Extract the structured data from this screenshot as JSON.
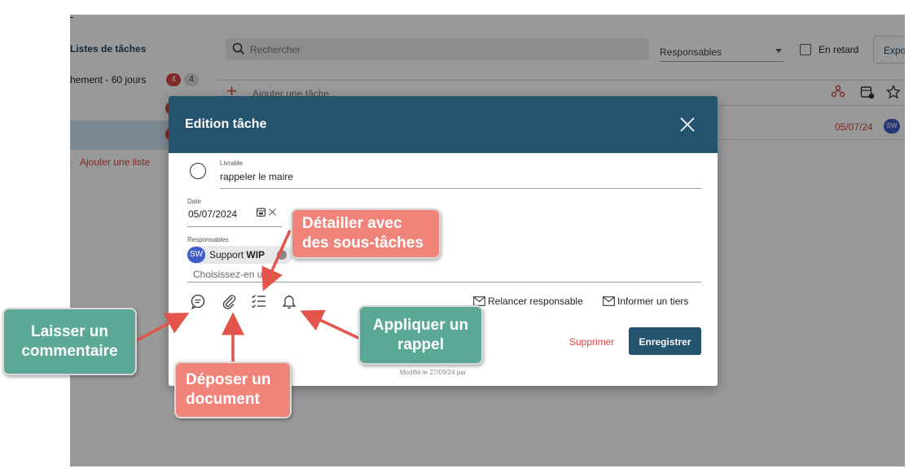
{
  "app": {
    "lists_title": "Listes de tâches",
    "list_item_label": "hement - 60 jours",
    "badge_red": "4",
    "badge_grey": "4",
    "add_list": "Ajouter une liste",
    "search_placeholder": "Rechercher",
    "responsables_select": "Responsables",
    "late_label": "En retard",
    "export_label": "Expo",
    "add_task": "Ajouter une tâche",
    "row_date": "05/07/24",
    "row_avatar": "SW"
  },
  "modal": {
    "title": "Edition tâche",
    "livrable_label": "Livrable",
    "livrable_value": "rappeler le maire",
    "date_label": "Date",
    "date_value": "05/07/2024",
    "responsables_label": "Responsables",
    "chip_avatar": "SW",
    "chip_name": "Support",
    "chip_name_bold": "WIP",
    "choose_placeholder": "Choisissez-en u",
    "relancer": "Relancer responsable",
    "informer": "Informer un tiers",
    "delete": "Supprimer",
    "save": "Enregistrer",
    "modified": "Modifié le 27/09/24 par"
  },
  "icons": [
    "search-icon",
    "caret-down-icon",
    "team-icon",
    "calendar-add-icon",
    "star-icon",
    "close-icon",
    "calendar-icon",
    "clear-icon",
    "comment-icon",
    "paperclip-icon",
    "checklist-icon",
    "bell-icon",
    "mail-icon"
  ],
  "callouts": {
    "comment_line1": "Laisser un",
    "comment_line2": "commentaire",
    "document_line1": "Déposer un",
    "document_line2": "document",
    "subtasks_line1": "Détailler avec",
    "subtasks_line2": "des sous-tâches",
    "reminder_line1": "Appliquer un",
    "reminder_line2": "rappel"
  },
  "colors": {
    "header": "#23536f",
    "accent_red": "#d64541",
    "callout_green": "#5aa895",
    "callout_salmon": "#f1847a",
    "arrow": "#e3554a"
  }
}
